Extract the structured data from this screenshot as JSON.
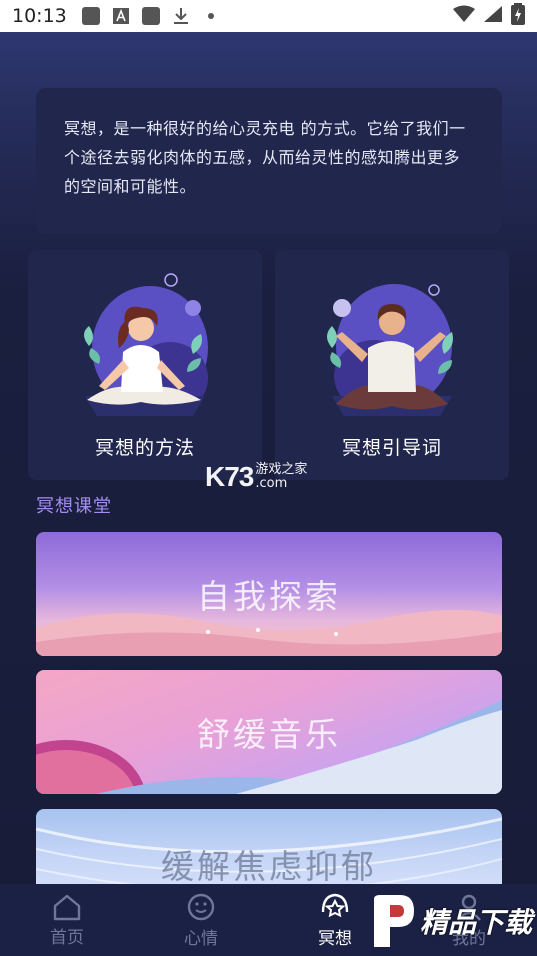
{
  "status_bar": {
    "time": "10:13",
    "icons_left": [
      "notification-square-icon",
      "a-letter-icon",
      "notification-square-icon",
      "download-icon",
      "dot-icon"
    ],
    "icons_right": [
      "wifi-icon",
      "signal-icon",
      "battery-charging-icon"
    ]
  },
  "intro": {
    "text": "冥想，是一种很好的给心灵充电 的方式。它给了我们一个途径去弱化肉体的五感，从而给灵性的感知腾出更多的空间和可能性。"
  },
  "features": [
    {
      "label": "冥想的方法"
    },
    {
      "label": "冥想引导词"
    }
  ],
  "watermark": {
    "logo": "K73",
    "cn": "游戏之家",
    "com": ".com"
  },
  "section": {
    "title": "冥想课堂"
  },
  "banners": [
    {
      "label": "自我探索"
    },
    {
      "label": "舒缓音乐"
    },
    {
      "label": "缓解焦虑抑郁"
    }
  ],
  "bottom_nav": {
    "items": [
      {
        "label": "首页",
        "icon": "home-icon"
      },
      {
        "label": "心情",
        "icon": "smiley-icon"
      },
      {
        "label": "冥想",
        "icon": "meditation-star-icon"
      },
      {
        "label": "我的",
        "icon": "user-icon"
      }
    ],
    "active_index": 2
  },
  "brand_watermark": {
    "text": "精品下载"
  },
  "colors": {
    "background": "#1a1f3f",
    "card": "#20264c",
    "section_title": "#a48cf0",
    "nav_inactive": "#6e7699",
    "nav_active": "#ffffff"
  }
}
